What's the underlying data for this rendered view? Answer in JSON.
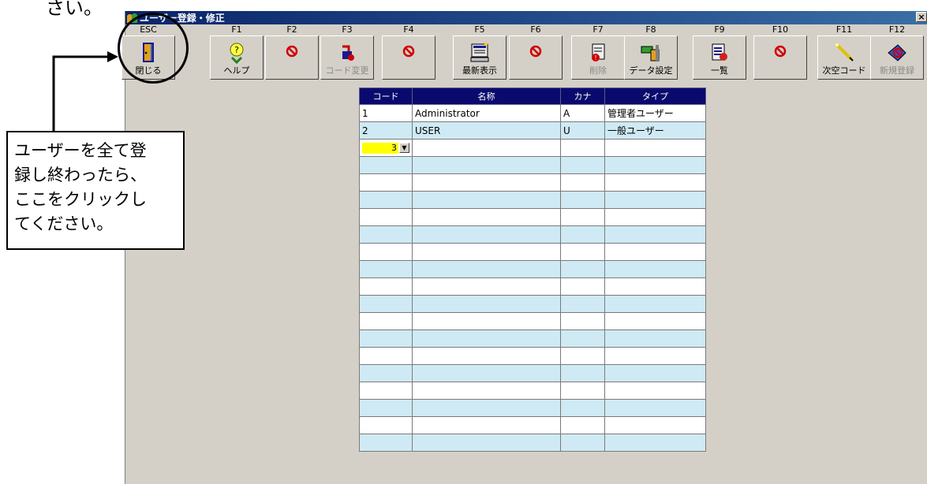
{
  "page_fragment": "さい。",
  "window": {
    "title": "ユーザー登録・修正",
    "close": "×"
  },
  "toolbar": [
    {
      "key": "ESC",
      "label": "閉じる",
      "icon": "door-icon",
      "enabled": true
    },
    {
      "key": "F1",
      "label": "ヘルプ",
      "icon": "help-bulb-icon",
      "enabled": true
    },
    {
      "key": "F2",
      "label": "",
      "icon": "prohibited-icon",
      "enabled": false
    },
    {
      "key": "F3",
      "label": "コード変更",
      "icon": "code-change-icon",
      "enabled": false
    },
    {
      "key": "F4",
      "label": "",
      "icon": "prohibited-icon",
      "enabled": false
    },
    {
      "key": "F5",
      "label": "最新表示",
      "icon": "refresh-display-icon",
      "enabled": true
    },
    {
      "key": "F6",
      "label": "",
      "icon": "prohibited-icon",
      "enabled": false
    },
    {
      "key": "F7",
      "label": "削除",
      "icon": "delete-icon",
      "enabled": false
    },
    {
      "key": "F8",
      "label": "データ設定",
      "icon": "data-setting-icon",
      "enabled": true
    },
    {
      "key": "F9",
      "label": "一覧",
      "icon": "list-icon",
      "enabled": true
    },
    {
      "key": "F10",
      "label": "",
      "icon": "prohibited-icon",
      "enabled": false
    },
    {
      "key": "F11",
      "label": "次空コード",
      "icon": "next-code-icon",
      "enabled": true
    },
    {
      "key": "F12",
      "label": "新規登録",
      "icon": "new-register-icon",
      "enabled": false
    }
  ],
  "grid": {
    "headers": [
      "コード",
      "名称",
      "カナ",
      "タイプ"
    ],
    "rows": [
      [
        "1",
        "Administrator",
        "A",
        "管理者ユーザー"
      ],
      [
        "2",
        "USER",
        "U",
        "一般ユーザー"
      ]
    ],
    "edit_row_code": "3"
  },
  "callout": {
    "lines": [
      "ユーザーを全て登",
      "録し終わったら、",
      "ここをクリックし",
      "てください。"
    ]
  },
  "colors": {
    "header_bg": "#0a0a6e",
    "row_blue": "#cfeaf4",
    "edit_yellow": "#ffff00",
    "window_bg": "#d4d0c8"
  }
}
